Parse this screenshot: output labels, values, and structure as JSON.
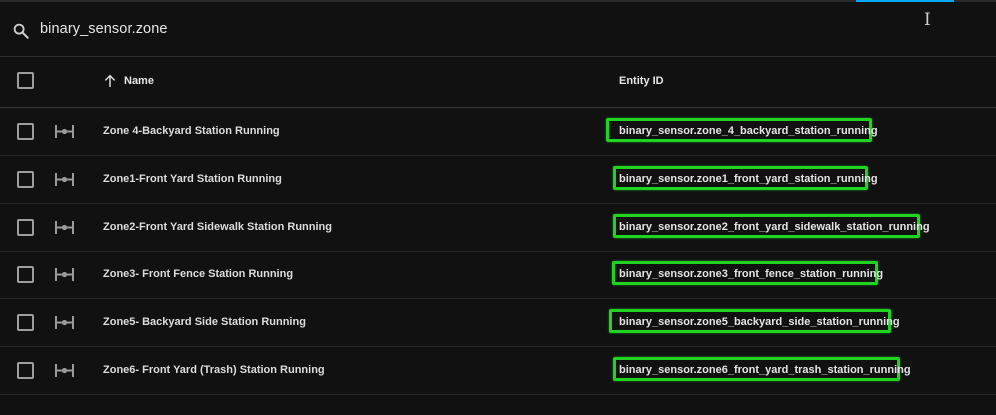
{
  "search": {
    "query": "binary_sensor.zone"
  },
  "table": {
    "columns": {
      "name": "Name",
      "entity_id": "Entity ID"
    },
    "sort": "ascending",
    "rows": [
      {
        "name": "Zone 4-Backyard Station Running",
        "entity_id": "binary_sensor.zone_4_backyard_station_running",
        "icon": "valve-icon",
        "highlighted": true
      },
      {
        "name": "Zone1-Front Yard Station Running",
        "entity_id": "binary_sensor.zone1_front_yard_station_running",
        "icon": "valve-icon",
        "highlighted": true
      },
      {
        "name": "Zone2-Front Yard Sidewalk Station Running",
        "entity_id": "binary_sensor.zone2_front_yard_sidewalk_station_running",
        "icon": "valve-icon",
        "highlighted": true
      },
      {
        "name": "Zone3- Front Fence Station Running",
        "entity_id": "binary_sensor.zone3_front_fence_station_running",
        "icon": "valve-icon",
        "highlighted": true
      },
      {
        "name": "Zone5- Backyard Side Station Running",
        "entity_id": "binary_sensor.zone5_backyard_side_station_running",
        "icon": "valve-icon",
        "highlighted": true
      },
      {
        "name": "Zone6- Front Yard (Trash) Station Running",
        "entity_id": "binary_sensor.zone6_front_yard_trash_station_running",
        "icon": "valve-icon",
        "highlighted": true
      }
    ]
  },
  "colors": {
    "background": "#111111",
    "highlight": "#21d321",
    "accent": "#03a9f4"
  }
}
